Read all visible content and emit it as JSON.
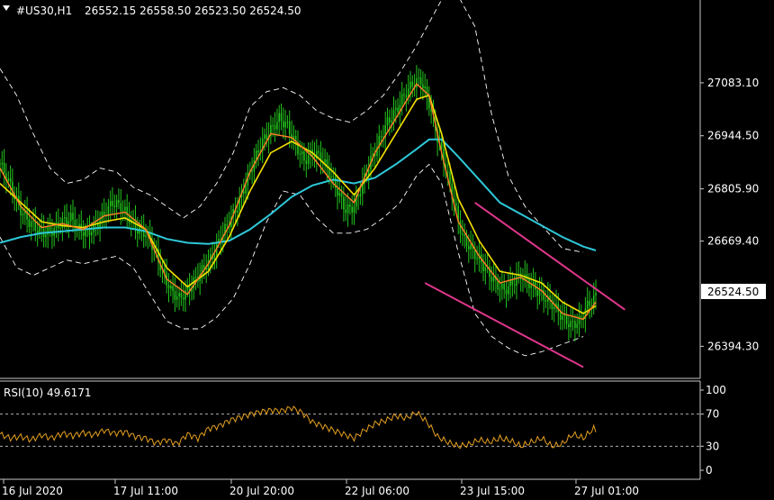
{
  "header": {
    "symbol": "#US30,H1",
    "ohlc": "26552.15 26558.50 26523.50 26524.50"
  },
  "price_axis": {
    "ticks": [
      "27083.10",
      "26944.50",
      "26805.90",
      "26669.40",
      "26394.30"
    ],
    "current_price": "26524.50"
  },
  "time_axis": {
    "ticks": [
      "16 Jul 2020",
      "17 Jul 11:00",
      "20 Jul 20:00",
      "22 Jul 06:00",
      "23 Jul 15:00",
      "27 Jul 01:00"
    ]
  },
  "rsi": {
    "label": "RSI(10) 49.6171",
    "ticks": [
      "100",
      "70",
      "30",
      "0"
    ]
  },
  "colors": {
    "background": "#000000",
    "candles": "#22c41c",
    "fast_ma": "#ff7f27",
    "slow_ma": "#f5e000",
    "long_ma": "#2ec8d8",
    "bands": "#ffffff",
    "trendline": "#e0368c",
    "rsi_line": "#e5a020",
    "grid_text": "#ffffff"
  },
  "chart_data": {
    "type": "line",
    "title": "#US30,H1",
    "y_axis_ticks": [
      27083.1,
      26944.5,
      26805.9,
      26669.4,
      26394.3
    ],
    "ylim": [
      26320,
      27290
    ],
    "close_path": [
      [
        0,
        26870
      ],
      [
        3,
        26840
      ],
      [
        6,
        26800
      ],
      [
        10,
        26750
      ],
      [
        14,
        26720
      ],
      [
        18,
        26700
      ],
      [
        22,
        26690
      ],
      [
        26,
        26700
      ],
      [
        30,
        26720
      ],
      [
        34,
        26730
      ],
      [
        38,
        26700
      ],
      [
        42,
        26690
      ],
      [
        46,
        26710
      ],
      [
        50,
        26740
      ],
      [
        54,
        26770
      ],
      [
        58,
        26760
      ],
      [
        62,
        26730
      ],
      [
        66,
        26700
      ],
      [
        70,
        26690
      ],
      [
        74,
        26650
      ],
      [
        78,
        26590
      ],
      [
        82,
        26540
      ],
      [
        86,
        26520
      ],
      [
        90,
        26540
      ],
      [
        94,
        26570
      ],
      [
        98,
        26600
      ],
      [
        102,
        26630
      ],
      [
        106,
        26680
      ],
      [
        110,
        26720
      ],
      [
        114,
        26760
      ],
      [
        118,
        26820
      ],
      [
        122,
        26880
      ],
      [
        126,
        26930
      ],
      [
        130,
        26960
      ],
      [
        134,
        26990
      ],
      [
        138,
        26970
      ],
      [
        142,
        26920
      ],
      [
        146,
        26880
      ],
      [
        150,
        26900
      ],
      [
        154,
        26890
      ],
      [
        158,
        26850
      ],
      [
        162,
        26800
      ],
      [
        166,
        26750
      ],
      [
        170,
        26760
      ],
      [
        174,
        26820
      ],
      [
        178,
        26880
      ],
      [
        182,
        26930
      ],
      [
        186,
        26980
      ],
      [
        190,
        27010
      ],
      [
        194,
        27050
      ],
      [
        198,
        27080
      ],
      [
        202,
        27090
      ],
      [
        206,
        27030
      ],
      [
        210,
        26940
      ],
      [
        214,
        26860
      ],
      [
        218,
        26770
      ],
      [
        222,
        26680
      ],
      [
        226,
        26650
      ],
      [
        230,
        26620
      ],
      [
        234,
        26590
      ],
      [
        238,
        26560
      ],
      [
        242,
        26540
      ],
      [
        246,
        26560
      ],
      [
        250,
        26580
      ],
      [
        254,
        26560
      ],
      [
        258,
        26540
      ],
      [
        262,
        26520
      ],
      [
        266,
        26500
      ],
      [
        270,
        26470
      ],
      [
        274,
        26450
      ],
      [
        278,
        26460
      ],
      [
        282,
        26500
      ],
      [
        286,
        26524.5
      ]
    ],
    "fast_ma_path": [
      [
        0,
        26860
      ],
      [
        10,
        26760
      ],
      [
        20,
        26705
      ],
      [
        30,
        26715
      ],
      [
        40,
        26700
      ],
      [
        50,
        26735
      ],
      [
        60,
        26745
      ],
      [
        70,
        26700
      ],
      [
        80,
        26570
      ],
      [
        90,
        26530
      ],
      [
        100,
        26610
      ],
      [
        110,
        26710
      ],
      [
        120,
        26850
      ],
      [
        130,
        26950
      ],
      [
        140,
        26940
      ],
      [
        150,
        26890
      ],
      [
        160,
        26820
      ],
      [
        170,
        26770
      ],
      [
        180,
        26900
      ],
      [
        190,
        26990
      ],
      [
        200,
        27080
      ],
      [
        206,
        27050
      ],
      [
        212,
        26900
      ],
      [
        220,
        26720
      ],
      [
        230,
        26630
      ],
      [
        240,
        26560
      ],
      [
        250,
        26575
      ],
      [
        260,
        26540
      ],
      [
        270,
        26480
      ],
      [
        280,
        26465
      ],
      [
        286,
        26510
      ]
    ],
    "slow_ma_path": [
      [
        0,
        26820
      ],
      [
        10,
        26770
      ],
      [
        20,
        26720
      ],
      [
        30,
        26710
      ],
      [
        40,
        26705
      ],
      [
        50,
        26720
      ],
      [
        60,
        26730
      ],
      [
        70,
        26700
      ],
      [
        80,
        26600
      ],
      [
        90,
        26550
      ],
      [
        100,
        26590
      ],
      [
        110,
        26680
      ],
      [
        120,
        26800
      ],
      [
        130,
        26900
      ],
      [
        140,
        26930
      ],
      [
        150,
        26900
      ],
      [
        160,
        26850
      ],
      [
        170,
        26790
      ],
      [
        180,
        26860
      ],
      [
        190,
        26950
      ],
      [
        200,
        27040
      ],
      [
        206,
        27050
      ],
      [
        212,
        26950
      ],
      [
        220,
        26780
      ],
      [
        230,
        26670
      ],
      [
        240,
        26590
      ],
      [
        250,
        26580
      ],
      [
        260,
        26560
      ],
      [
        270,
        26510
      ],
      [
        280,
        26480
      ],
      [
        286,
        26500
      ]
    ],
    "long_ma_path": [
      [
        0,
        26665
      ],
      [
        10,
        26680
      ],
      [
        20,
        26690
      ],
      [
        30,
        26695
      ],
      [
        40,
        26700
      ],
      [
        50,
        26705
      ],
      [
        60,
        26705
      ],
      [
        70,
        26695
      ],
      [
        80,
        26675
      ],
      [
        90,
        26665
      ],
      [
        100,
        26662
      ],
      [
        110,
        26670
      ],
      [
        120,
        26700
      ],
      [
        130,
        26740
      ],
      [
        140,
        26785
      ],
      [
        150,
        26815
      ],
      [
        160,
        26830
      ],
      [
        170,
        26820
      ],
      [
        180,
        26835
      ],
      [
        190,
        26870
      ],
      [
        200,
        26910
      ],
      [
        206,
        26935
      ],
      [
        212,
        26935
      ],
      [
        220,
        26890
      ],
      [
        230,
        26830
      ],
      [
        240,
        26770
      ],
      [
        250,
        26740
      ],
      [
        260,
        26710
      ],
      [
        270,
        26680
      ],
      [
        280,
        26655
      ],
      [
        286,
        26645
      ]
    ],
    "upper_band_path": [
      [
        0,
        27120
      ],
      [
        8,
        27050
      ],
      [
        16,
        26950
      ],
      [
        24,
        26860
      ],
      [
        32,
        26820
      ],
      [
        40,
        26830
      ],
      [
        48,
        26860
      ],
      [
        56,
        26850
      ],
      [
        64,
        26810
      ],
      [
        72,
        26790
      ],
      [
        80,
        26760
      ],
      [
        88,
        26730
      ],
      [
        96,
        26760
      ],
      [
        104,
        26820
      ],
      [
        112,
        26900
      ],
      [
        120,
        27020
      ],
      [
        128,
        27060
      ],
      [
        136,
        27070
      ],
      [
        144,
        27050
      ],
      [
        152,
        27010
      ],
      [
        160,
        26990
      ],
      [
        168,
        26980
      ],
      [
        176,
        27010
      ],
      [
        184,
        27050
      ],
      [
        192,
        27110
      ],
      [
        200,
        27180
      ],
      [
        206,
        27240
      ],
      [
        212,
        27300
      ],
      [
        220,
        27310
      ],
      [
        228,
        27230
      ],
      [
        236,
        27000
      ],
      [
        244,
        26840
      ],
      [
        252,
        26760
      ],
      [
        260,
        26710
      ],
      [
        270,
        26650
      ],
      [
        280,
        26640
      ]
    ],
    "lower_band_path": [
      [
        0,
        26680
      ],
      [
        8,
        26600
      ],
      [
        16,
        26580
      ],
      [
        24,
        26600
      ],
      [
        32,
        26620
      ],
      [
        40,
        26610
      ],
      [
        48,
        26620
      ],
      [
        56,
        26630
      ],
      [
        64,
        26600
      ],
      [
        72,
        26530
      ],
      [
        80,
        26460
      ],
      [
        88,
        26440
      ],
      [
        96,
        26440
      ],
      [
        104,
        26470
      ],
      [
        112,
        26520
      ],
      [
        120,
        26610
      ],
      [
        128,
        26720
      ],
      [
        136,
        26800
      ],
      [
        144,
        26790
      ],
      [
        152,
        26730
      ],
      [
        160,
        26690
      ],
      [
        168,
        26690
      ],
      [
        176,
        26700
      ],
      [
        184,
        26730
      ],
      [
        192,
        26770
      ],
      [
        200,
        26840
      ],
      [
        206,
        26870
      ],
      [
        212,
        26820
      ],
      [
        220,
        26640
      ],
      [
        228,
        26480
      ],
      [
        236,
        26420
      ],
      [
        244,
        26390
      ],
      [
        252,
        26370
      ],
      [
        260,
        26380
      ],
      [
        270,
        26400
      ],
      [
        280,
        26420
      ]
    ],
    "trendlines": [
      {
        "from": [
          228,
          26770
        ],
        "to": [
          300,
          26490
        ]
      },
      {
        "from": [
          204,
          26560
        ],
        "to": [
          280,
          26340
        ]
      }
    ],
    "rsi_series": {
      "name": "RSI(10)",
      "ylim": [
        0,
        100
      ],
      "levels": [
        70,
        30
      ],
      "values": [
        [
          0,
          45
        ],
        [
          5,
          40
        ],
        [
          10,
          42
        ],
        [
          15,
          38
        ],
        [
          20,
          44
        ],
        [
          25,
          40
        ],
        [
          30,
          46
        ],
        [
          35,
          43
        ],
        [
          40,
          47
        ],
        [
          45,
          44
        ],
        [
          50,
          50
        ],
        [
          55,
          46
        ],
        [
          60,
          48
        ],
        [
          65,
          42
        ],
        [
          70,
          40
        ],
        [
          75,
          34
        ],
        [
          80,
          38
        ],
        [
          85,
          33
        ],
        [
          90,
          45
        ],
        [
          95,
          40
        ],
        [
          100,
          52
        ],
        [
          105,
          55
        ],
        [
          110,
          62
        ],
        [
          115,
          66
        ],
        [
          120,
          70
        ],
        [
          125,
          73
        ],
        [
          130,
          75
        ],
        [
          135,
          74
        ],
        [
          140,
          78
        ],
        [
          145,
          72
        ],
        [
          150,
          60
        ],
        [
          155,
          55
        ],
        [
          160,
          50
        ],
        [
          165,
          45
        ],
        [
          170,
          40
        ],
        [
          175,
          50
        ],
        [
          180,
          58
        ],
        [
          185,
          62
        ],
        [
          190,
          68
        ],
        [
          195,
          65
        ],
        [
          200,
          72
        ],
        [
          205,
          60
        ],
        [
          210,
          42
        ],
        [
          215,
          35
        ],
        [
          220,
          30
        ],
        [
          225,
          32
        ],
        [
          230,
          38
        ],
        [
          235,
          35
        ],
        [
          240,
          40
        ],
        [
          245,
          37
        ],
        [
          250,
          30
        ],
        [
          255,
          35
        ],
        [
          260,
          40
        ],
        [
          265,
          30
        ],
        [
          270,
          33
        ],
        [
          275,
          45
        ],
        [
          280,
          40
        ],
        [
          285,
          52
        ],
        [
          286,
          49.6
        ]
      ]
    }
  }
}
